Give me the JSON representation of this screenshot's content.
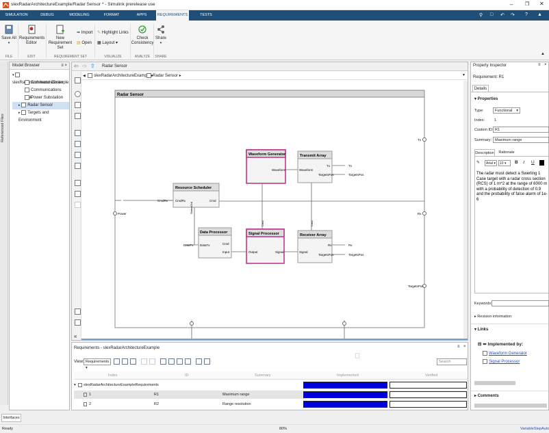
{
  "window": {
    "title": "slexRadarArchitectureExample/Radar Sensor * - Simulink prerelease use"
  },
  "tabs": [
    "SIMULATION",
    "DEBUG",
    "MODELING",
    "FORMAT",
    "APPS",
    "REQUIREMENTS",
    "TESTS"
  ],
  "ribbon": {
    "save_all": "Save All",
    "req_editor_1": "Requirements",
    "req_editor_2": "Editor",
    "new_set_1": "New",
    "new_set_2": "Requirement Set",
    "import": "Import",
    "open": "Open",
    "highlight": "Highlight Links",
    "layout": "Layout",
    "check_1": "Check",
    "check_2": "Consistency",
    "share": "Share",
    "sec_file": "FILE",
    "sec_edit": "EDIT",
    "sec_req_set": "REQUIREMENT SET",
    "sec_visualize": "VISUALIZE",
    "sec_analyze": "ANALYZE",
    "sec_share": "SHARE"
  },
  "side_tab": "Referenced Files",
  "model_browser": {
    "title": "Model Browser",
    "root": "slexRadarArchitectureExample",
    "items": [
      "Command Center",
      "Communications Link",
      "Power Substation",
      "Radar Sensor",
      "Targets and Environment"
    ]
  },
  "canvas": {
    "nav_title": "Radar Sensor",
    "breadcrumb_root": "slexRadarArchitectureExample",
    "breadcrumb_current": "Radar Sensor",
    "frame_title": "Radar Sensor",
    "components": {
      "waveform_generator": "Waveform Generator",
      "transmit_array": "Transmit Array",
      "resource_scheduler": "Resource Scheduler",
      "data_processor": "Data Processor",
      "signal_processor": "Signal Processor",
      "receiver_array": "Receiver Array"
    },
    "ports": {
      "waveform": "Waveform",
      "tx": "Tx",
      "targets_pos": "TargetsPos",
      "cmd_rx": "CmdRx",
      "cmd": "Cmd",
      "status_out": "StatusOut",
      "data_tx": "DataTx",
      "input": "Input",
      "output": "Output",
      "signal": "Signal",
      "rx": "Rx",
      "power": "Power"
    }
  },
  "requirements": {
    "title": "Requirements - slexRadarArchitectureExample",
    "view_label": "View:",
    "view_value": "Requirements",
    "search_placeholder": "Search",
    "columns": [
      "Index",
      "ID",
      "Summary",
      "Implemented",
      "Verified"
    ],
    "set_name": "slexRadarArchitectureExampleRequirements",
    "rows": [
      {
        "index": "1",
        "id": "R1",
        "summary": "Maximum range"
      },
      {
        "index": "2",
        "id": "R2",
        "summary": "Range resolution"
      }
    ]
  },
  "inspector": {
    "title": "Property Inspector",
    "subtitle": "Requirement: R1",
    "tab": "Details",
    "properties_label": "Properties",
    "type_label": "Type:",
    "type_value": "Functional",
    "index_label": "Index:",
    "index_value": "1",
    "custom_id_label": "Custom ID:",
    "custom_id_value": "R1",
    "summary_label": "Summary:",
    "summary_value": "Maximum range",
    "desc_tab": "Description",
    "rationale_tab": "Rationale",
    "font_name": "Arial",
    "font_size": "10",
    "bold": "B",
    "italic": "I",
    "underline": "U",
    "description": "The radar must detect a Swerling 1 Case target with a radar cross section (RCS) of 1 m^2 at the range of 6000 m with a probability of detection of 0.9 and the probability of false alarm of 1e-6",
    "keywords_label": "Keywords:",
    "revision_label": "Revision information:",
    "links_label": "Links",
    "implemented_by": "Implemented by:",
    "link1": "Waveform Generator",
    "link2": "Signal Processor",
    "comments_label": "Comments"
  },
  "bottom": {
    "interfaces_tab": "Interfaces",
    "status_left": "Ready",
    "zoom": "80%",
    "solver": "VariableStepAuto"
  },
  "colors": {
    "accent": "#1f4e79",
    "highlight": "#c0398e",
    "bar": "#0000dd"
  }
}
